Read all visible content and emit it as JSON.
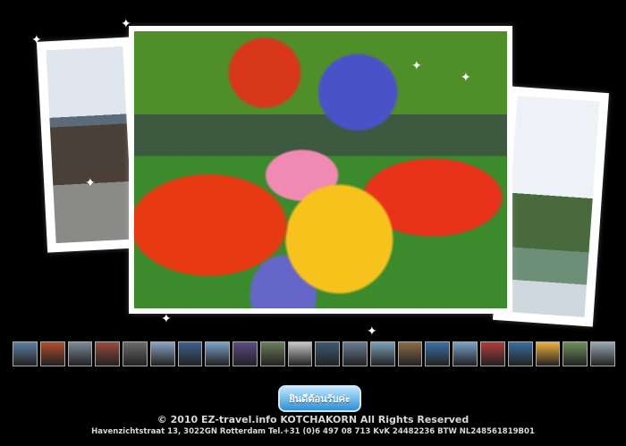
{
  "slideshow": {
    "thumb_colors": [
      "#5d7fa3",
      "#b44c2a",
      "#7c8a9a",
      "#9a4b3b",
      "#6a6a6a",
      "#8aa4c2",
      "#3f5f8d",
      "#7aa1c7",
      "#5b4b86",
      "#6b7e5a",
      "#c8c8c8",
      "#3d5a75",
      "#6a7b92",
      "#7aa0b8",
      "#8c6c4a",
      "#3c6ea8",
      "#7aa1c7",
      "#b33b3b",
      "#3a6da1",
      "#f0b23b",
      "#6c8f5b",
      "#9aa8b3"
    ]
  },
  "button": {
    "label": "ยินดีต้อนรับค่ะ"
  },
  "footer": {
    "copyright": "© 2010 EZ-travel.info  KOTCHAKORN All Rights Reserved",
    "address": "Havenzichtstraat 13, 3022GN Rotterdam Tel.+31 (0)6 497 08 713 KvK 24482236 BTW NL248561819B01"
  }
}
